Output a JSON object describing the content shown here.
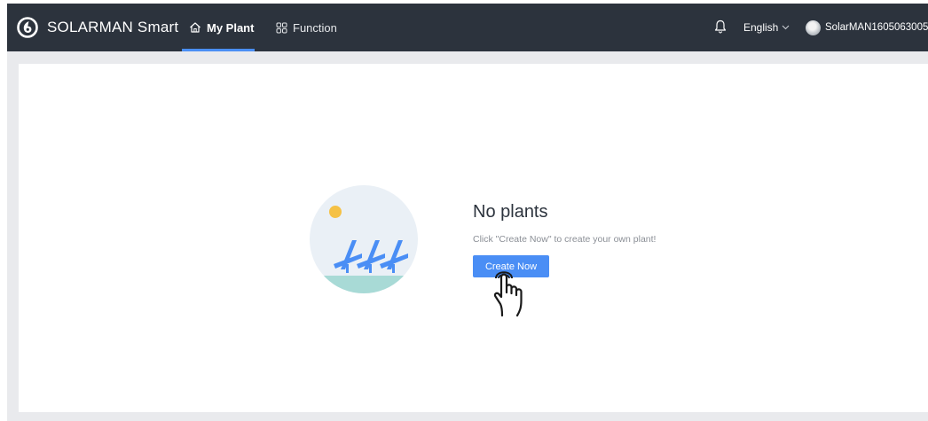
{
  "header": {
    "brand": "SOLARMAN Smart",
    "nav": [
      {
        "label": "My Plant",
        "icon": "home-icon",
        "active": true
      },
      {
        "label": "Function",
        "icon": "grid-icon",
        "active": false
      }
    ],
    "notifications_icon": "bell-icon",
    "language": "English",
    "username": "SolarMAN1605063005"
  },
  "empty_state": {
    "title": "No plants",
    "description": "Click \"Create Now\" to create your own plant!",
    "button_label": "Create Now"
  },
  "colors": {
    "header_bg": "#2c333d",
    "accent": "#4a8ef5",
    "page_bg": "#e9eaed",
    "sun": "#f5c145",
    "illustration_bg": "#eaf0f6",
    "ground": "#a8dad6"
  }
}
